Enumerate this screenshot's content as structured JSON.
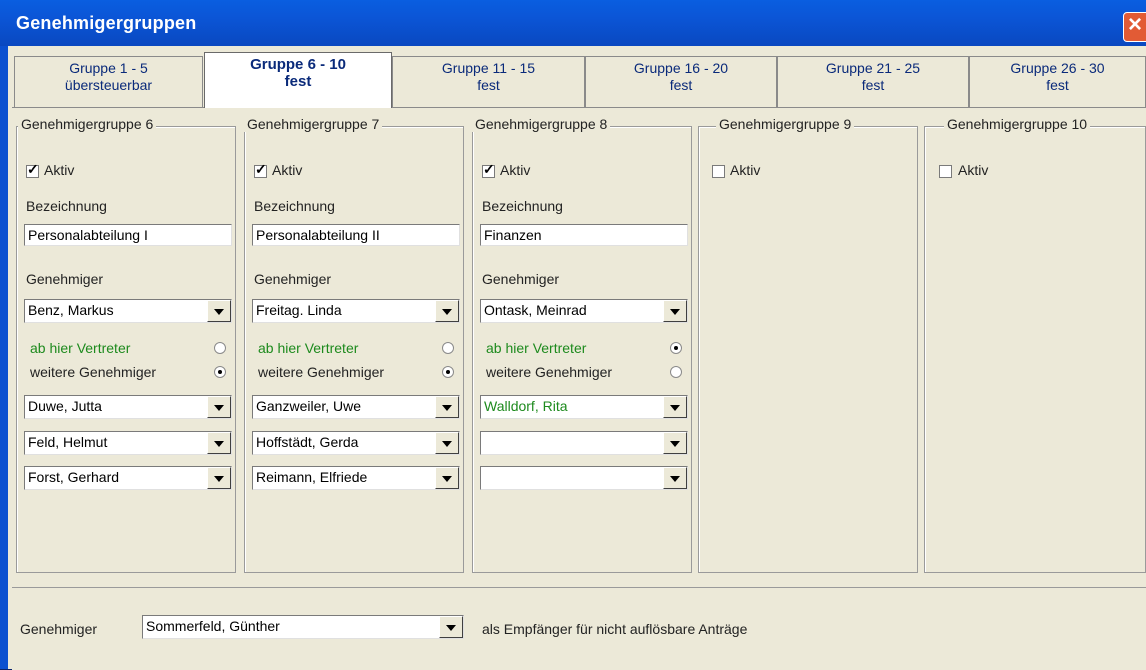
{
  "window": {
    "title": "Genehmigergruppen",
    "close_icon": "close-icon"
  },
  "tabs": [
    {
      "line1": "Gruppe 1 - 5",
      "line2": "übersteuerbar"
    },
    {
      "line1": "Gruppe 6 - 10",
      "line2": "fest",
      "active": true
    },
    {
      "line1": "Gruppe 11 - 15",
      "line2": "fest"
    },
    {
      "line1": "Gruppe 16 - 20",
      "line2": "fest"
    },
    {
      "line1": "Gruppe 21 - 25",
      "line2": "fest"
    },
    {
      "line1": "Gruppe 26 - 30",
      "line2": "fest"
    }
  ],
  "labels": {
    "aktiv": "Aktiv",
    "bezeichnung": "Bezeichnung",
    "genehmiger": "Genehmiger",
    "vertreter": "ab hier Vertreter",
    "weitere": "weitere Genehmiger"
  },
  "groups": [
    {
      "title": "Genehmigergruppe 6",
      "aktiv": true,
      "bezeichnung": "Personalabteilung I",
      "genehmiger": "Benz, Markus",
      "mode": "weitere",
      "extra": [
        "Duwe, Jutta",
        "Feld, Helmut",
        "Forst, Gerhard"
      ]
    },
    {
      "title": "Genehmigergruppe 7",
      "aktiv": true,
      "bezeichnung": "Personalabteilung II",
      "genehmiger": "Freitag. Linda",
      "mode": "weitere",
      "extra": [
        "Ganzweiler, Uwe",
        "Hoffstädt, Gerda",
        "Reimann, Elfriede"
      ]
    },
    {
      "title": "Genehmigergruppe 8",
      "aktiv": true,
      "bezeichnung": "Finanzen",
      "genehmiger": "Ontask, Meinrad",
      "mode": "vertreter",
      "extra": [
        "Walldorf, Rita",
        "",
        ""
      ]
    },
    {
      "title": "Genehmigergruppe 9",
      "aktiv": false
    },
    {
      "title": "Genehmigergruppe 10",
      "aktiv": false
    }
  ],
  "bottom": {
    "label": "Genehmiger",
    "value": "Sommerfeld, Günther",
    "suffix": "als Empfänger für nicht auflösbare Anträge"
  },
  "colors": {
    "vertreter_text": "#1d8a1d",
    "titlebar": "#0a55d6"
  }
}
